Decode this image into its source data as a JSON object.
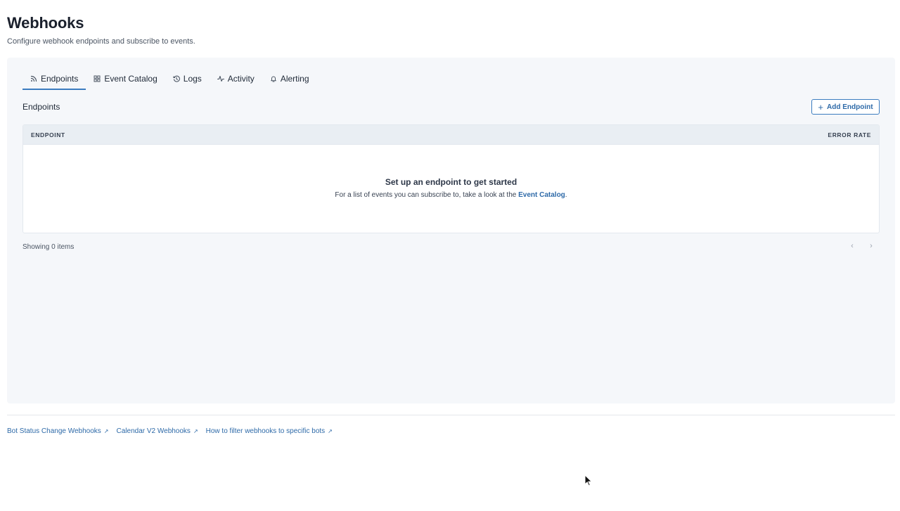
{
  "header": {
    "title": "Webhooks",
    "subtitle": "Configure webhook endpoints and subscribe to events."
  },
  "tabs": [
    {
      "label": "Endpoints",
      "icon": "rss-icon",
      "active": true
    },
    {
      "label": "Event Catalog",
      "icon": "grid-icon",
      "active": false
    },
    {
      "label": "Logs",
      "icon": "history-icon",
      "active": false
    },
    {
      "label": "Activity",
      "icon": "activity-icon",
      "active": false
    },
    {
      "label": "Alerting",
      "icon": "bell-icon",
      "active": false
    }
  ],
  "endpoints": {
    "section_label": "Endpoints",
    "add_button_label": "Add Endpoint",
    "columns": [
      "ENDPOINT",
      "ERROR RATE"
    ],
    "empty_title": "Set up an endpoint to get started",
    "empty_text_prefix": "For a list of events you can subscribe to, take a look at the",
    "empty_text_link": "Event Catalog",
    "empty_text_suffix": ".",
    "showing": "Showing 0 items"
  },
  "footer": {
    "links": [
      {
        "label": "Bot Status Change Webhooks"
      },
      {
        "label": "Calendar V2 Webhooks"
      },
      {
        "label": "How to filter webhooks to specific bots"
      }
    ]
  },
  "colors": {
    "accent": "#3b7cbf",
    "link": "#2e6aa8",
    "panel_bg": "#f5f7fa"
  }
}
